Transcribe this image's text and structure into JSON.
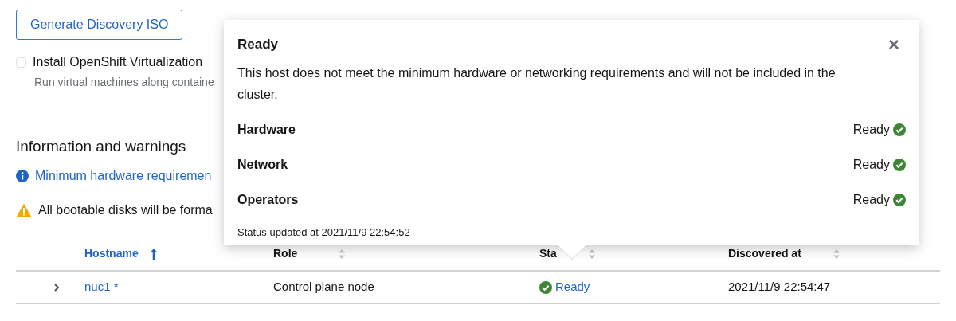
{
  "generate_button": "Generate Discovery ISO",
  "virtualization": {
    "label": "Install OpenShift Virtualization",
    "checked": false,
    "help": "Run virtual machines along containe"
  },
  "section_title": "Information and warnings",
  "alerts": [
    {
      "kind": "info",
      "text": "Minimum hardware requiremen"
    },
    {
      "kind": "warning",
      "text": "All bootable disks will be forma"
    }
  ],
  "table": {
    "columns": [
      {
        "label": "Hostname",
        "sorted": true
      },
      {
        "label": "Role",
        "sorted": false
      },
      {
        "label": "Sta",
        "sorted": false
      },
      {
        "label": "Discovered at",
        "sorted": false
      }
    ],
    "rows": [
      {
        "expanded": false,
        "hostname": "nuc1 *",
        "role": "Control plane node",
        "status": "Ready",
        "discovered_at": "2021/11/9 22:54:47"
      }
    ]
  },
  "popover": {
    "title": "Ready",
    "close": "×",
    "message": "This host does not meet the minimum hardware or networking requirements and will not be included in the cluster.",
    "checks": [
      {
        "label": "Hardware",
        "status": "Ready"
      },
      {
        "label": "Network",
        "status": "Ready"
      },
      {
        "label": "Operators",
        "status": "Ready"
      }
    ],
    "footer": "Status updated at 2021/11/9 22:54:52"
  }
}
